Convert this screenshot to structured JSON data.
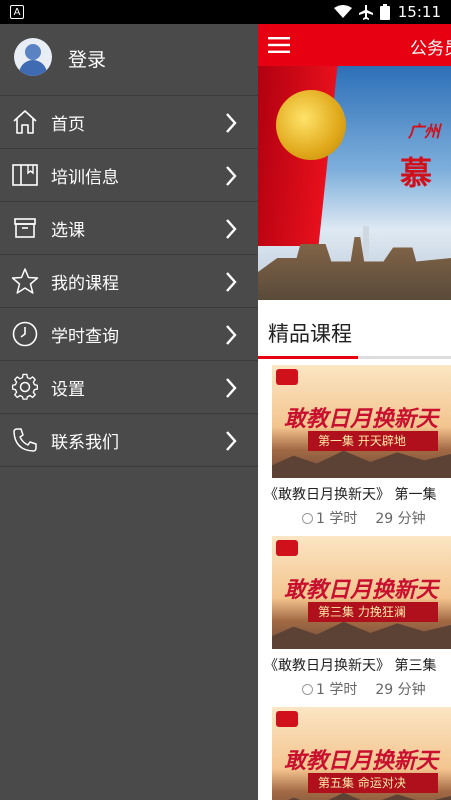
{
  "status_bar": {
    "time": "15:11"
  },
  "drawer": {
    "login_label": "登录",
    "items": [
      {
        "label": "首页",
        "icon": "home-icon"
      },
      {
        "label": "培训信息",
        "icon": "book-icon"
      },
      {
        "label": "选课",
        "icon": "archive-icon"
      },
      {
        "label": "我的课程",
        "icon": "star-icon"
      },
      {
        "label": "学时查询",
        "icon": "clock-icon"
      },
      {
        "label": "设置",
        "icon": "gear-icon"
      },
      {
        "label": "联系我们",
        "icon": "phone-icon"
      }
    ]
  },
  "main": {
    "title": "公务员",
    "banner": {
      "subtitle": "广州",
      "title": "慕"
    },
    "section_title": "精品课程",
    "courses": [
      {
        "thumb_title": "敢教日月换新天",
        "thumb_episode": "第一集  开天辟地",
        "name": "《敢教日月换新天》 第一集",
        "hours": "1 学时",
        "duration": "29 分钟"
      },
      {
        "thumb_title": "敢教日月换新天",
        "thumb_episode": "第三集  力挽狂澜",
        "name": "《敢教日月换新天》 第三集",
        "hours": "1 学时",
        "duration": "29 分钟"
      },
      {
        "thumb_title": "敢教日月换新天",
        "thumb_episode": "第五集  命运对决"
      }
    ]
  },
  "colors": {
    "accent": "#e60012",
    "drawer_bg": "#4a4a4a"
  }
}
